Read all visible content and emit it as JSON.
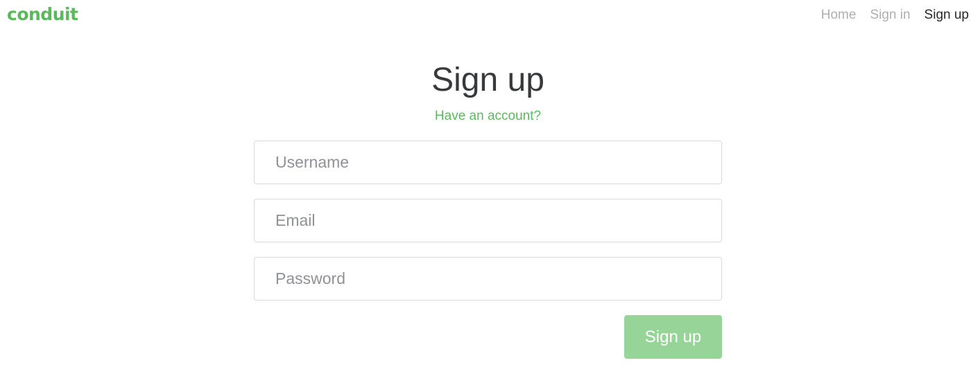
{
  "navbar": {
    "brand": "conduit",
    "links": [
      {
        "label": "Home",
        "active": false
      },
      {
        "label": "Sign in",
        "active": false
      },
      {
        "label": "Sign up",
        "active": true
      }
    ]
  },
  "auth": {
    "title": "Sign up",
    "subtitle_link": "Have an account?",
    "fields": {
      "username": {
        "placeholder": "Username",
        "value": ""
      },
      "email": {
        "placeholder": "Email",
        "value": ""
      },
      "password": {
        "placeholder": "Password",
        "value": ""
      }
    },
    "submit_label": "Sign up"
  },
  "colors": {
    "brand": "#5cb85c",
    "button": "#97d497",
    "title": "#373a3c"
  }
}
